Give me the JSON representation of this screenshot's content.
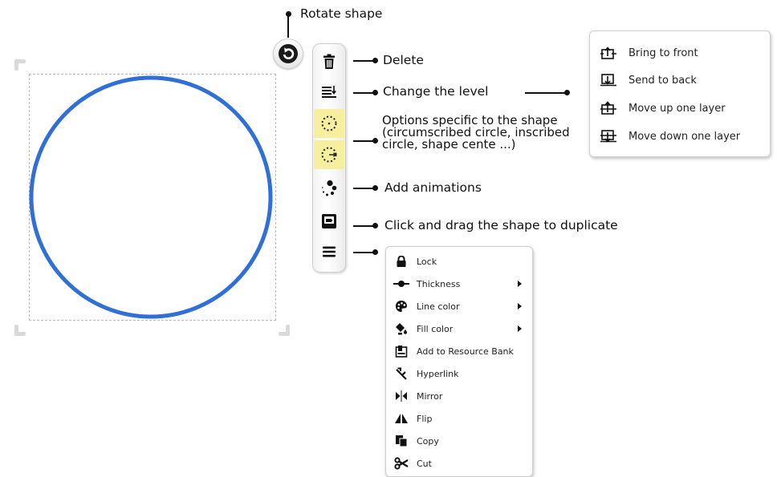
{
  "callouts": {
    "rotate": "Rotate shape",
    "delete": "Delete",
    "level": "Change the level",
    "options": "Options specific to the shape (circumscribed circle, inscribed circle, shape cente ...)",
    "animations": "Add animations",
    "duplicate": "Click and drag the shape to duplicate"
  },
  "shape": {
    "type": "circle",
    "stroke_color": "#2f6fd6",
    "selection_border_color": "#b8b8b8"
  },
  "toolbar": {
    "buttons": [
      {
        "name": "delete",
        "icon": "trash-icon"
      },
      {
        "name": "change-level",
        "icon": "layers-icon"
      },
      {
        "name": "circumscribed-circle",
        "icon": "dotted-circle-icon",
        "highlight": "#f6ef9e"
      },
      {
        "name": "shape-center",
        "icon": "dotted-circle-arrow-icon",
        "highlight": "#f6ef9e"
      },
      {
        "name": "add-animations",
        "icon": "animation-dots-icon"
      },
      {
        "name": "duplicate",
        "icon": "duplicate-icon"
      },
      {
        "name": "menu",
        "icon": "hamburger-icon"
      }
    ]
  },
  "level_menu": {
    "items": [
      {
        "label": "Bring to front",
        "icon": "bring-to-front-icon"
      },
      {
        "label": "Send to back",
        "icon": "send-to-back-icon"
      },
      {
        "label": "Move up one layer",
        "icon": "move-up-layer-icon"
      },
      {
        "label": "Move down one layer",
        "icon": "move-down-layer-icon"
      }
    ]
  },
  "context_menu": {
    "items": [
      {
        "label": "Lock",
        "icon": "lock-icon",
        "submenu": false
      },
      {
        "label": "Thickness",
        "icon": "thickness-icon",
        "submenu": true
      },
      {
        "label": "Line color",
        "icon": "palette-icon",
        "submenu": true
      },
      {
        "label": "Fill color",
        "icon": "paint-bucket-icon",
        "submenu": true
      },
      {
        "label": "Add to Resource Bank",
        "icon": "resource-bank-icon",
        "submenu": false
      },
      {
        "label": "Hyperlink",
        "icon": "hyperlink-icon",
        "submenu": false
      },
      {
        "label": "Mirror",
        "icon": "mirror-icon",
        "submenu": false
      },
      {
        "label": "Flip",
        "icon": "flip-icon",
        "submenu": false
      },
      {
        "label": "Copy",
        "icon": "copy-icon",
        "submenu": false
      },
      {
        "label": "Cut",
        "icon": "scissors-icon",
        "submenu": false
      }
    ]
  }
}
